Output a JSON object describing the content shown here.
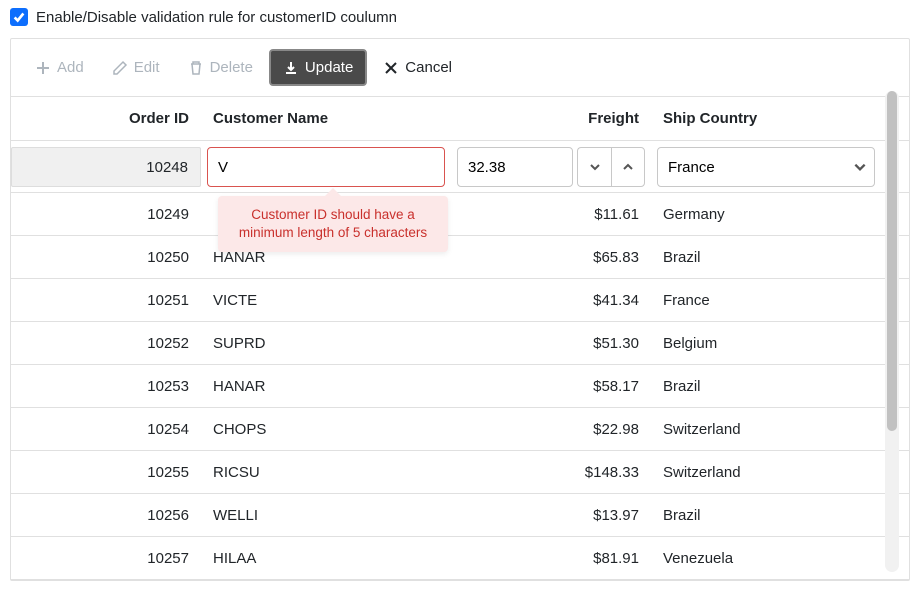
{
  "checkbox_label": "Enable/Disable validation rule for customerID coulumn",
  "toolbar": {
    "add": "Add",
    "edit": "Edit",
    "delete": "Delete",
    "update": "Update",
    "cancel": "Cancel"
  },
  "columns": {
    "order_id": "Order ID",
    "customer_name": "Customer Name",
    "freight": "Freight",
    "ship_country": "Ship Country"
  },
  "edit_row": {
    "order_id": "10248",
    "customer_value": "V",
    "freight_value": "32.38",
    "ship_country_value": "France"
  },
  "validation_msg": "Customer ID should have a minimum length of 5 characters",
  "rows": [
    {
      "order_id": "10249",
      "customer": "",
      "freight": "$11.61",
      "country": "Germany"
    },
    {
      "order_id": "10250",
      "customer": "HANAR",
      "freight": "$65.83",
      "country": "Brazil"
    },
    {
      "order_id": "10251",
      "customer": "VICTE",
      "freight": "$41.34",
      "country": "France"
    },
    {
      "order_id": "10252",
      "customer": "SUPRD",
      "freight": "$51.30",
      "country": "Belgium"
    },
    {
      "order_id": "10253",
      "customer": "HANAR",
      "freight": "$58.17",
      "country": "Brazil"
    },
    {
      "order_id": "10254",
      "customer": "CHOPS",
      "freight": "$22.98",
      "country": "Switzerland"
    },
    {
      "order_id": "10255",
      "customer": "RICSU",
      "freight": "$148.33",
      "country": "Switzerland"
    },
    {
      "order_id": "10256",
      "customer": "WELLI",
      "freight": "$13.97",
      "country": "Brazil"
    },
    {
      "order_id": "10257",
      "customer": "HILAA",
      "freight": "$81.91",
      "country": "Venezuela"
    }
  ]
}
